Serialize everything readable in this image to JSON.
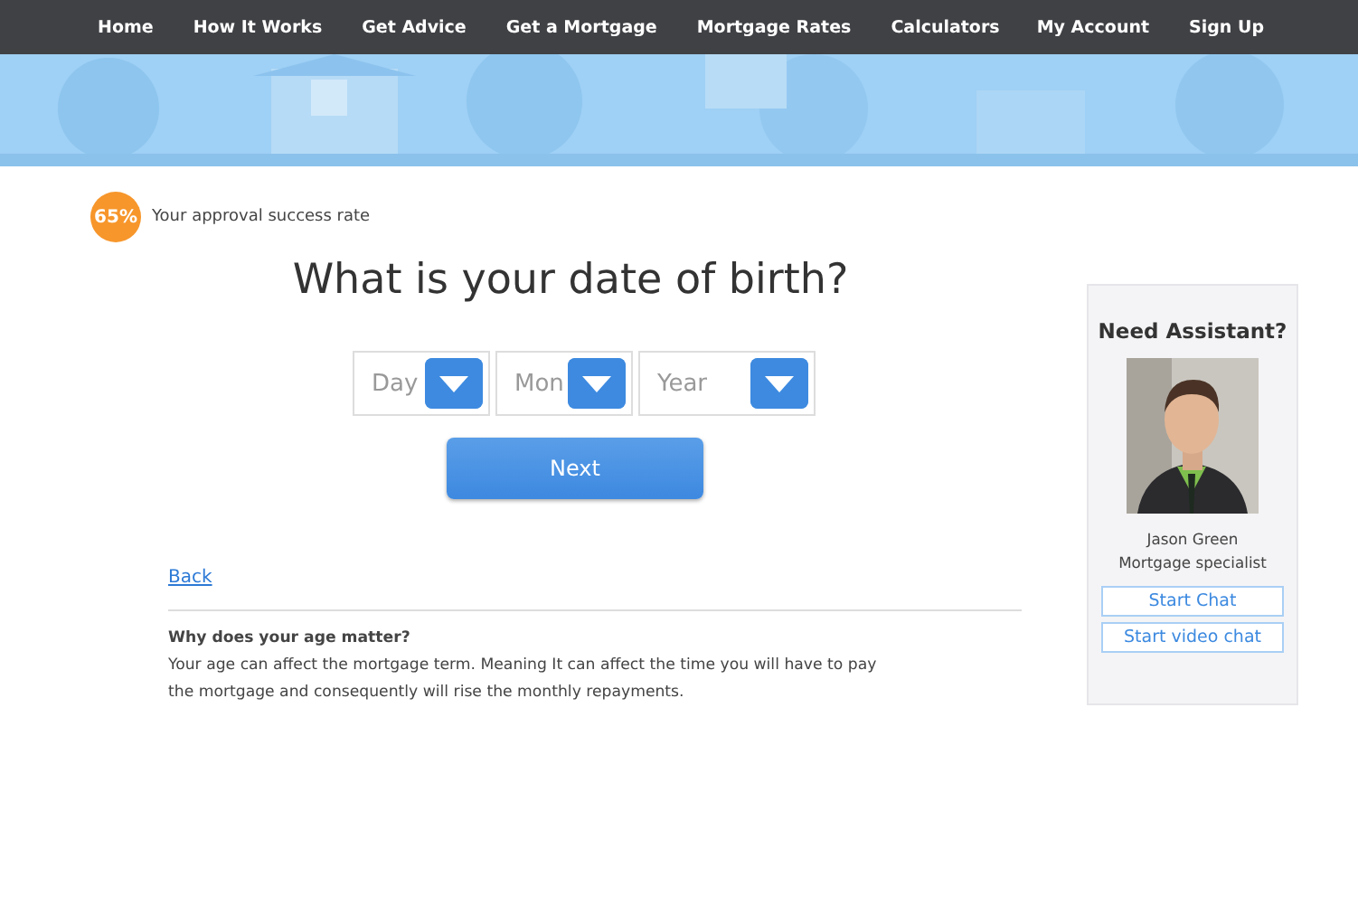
{
  "nav": {
    "left": [
      {
        "label": "Home"
      },
      {
        "label": "How It Works"
      },
      {
        "label": "Get Advice"
      },
      {
        "label": "Get a Mortgage"
      },
      {
        "label": "Mortgage Rates"
      },
      {
        "label": "Calculators"
      }
    ],
    "right": [
      {
        "label": "My Account"
      },
      {
        "label": "Sign Up"
      }
    ]
  },
  "banner": {
    "kind": "picture"
  },
  "progress": {
    "badge": "65%",
    "label": "Your approval success rate"
  },
  "question": "What is your date of birth?",
  "dropdowns": [
    {
      "placeholder": "Day"
    },
    {
      "placeholder": "Mon"
    },
    {
      "placeholder": "Year"
    }
  ],
  "next_button": "Next",
  "back_link": "Back",
  "info": {
    "heading": "Why does your age matter?",
    "lines": [
      "Your age can affect the mortgage term.  Meaning It can affect the time you will have to pay",
      "the mortgage and consequently will rise the monthly repayments."
    ]
  },
  "assistant": {
    "title": "Need Assistant?",
    "photo": {
      "kind": "picture"
    },
    "name": "Jason Green",
    "role": "Mortgage specialist",
    "buttons": [
      "Start Chat",
      "Start video chat"
    ]
  }
}
